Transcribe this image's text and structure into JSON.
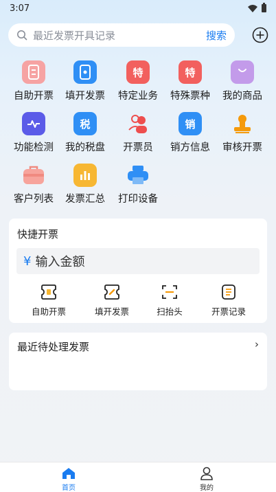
{
  "status": {
    "time": "3:07"
  },
  "search": {
    "placeholder": "最近发票开具记录",
    "button": "搜索"
  },
  "grid": [
    {
      "label": "自助开票",
      "icon": "self-invoice-icon",
      "color": "#f6a3a3"
    },
    {
      "label": "填开发票",
      "icon": "fill-invoice-icon",
      "color": "#2f8ff5"
    },
    {
      "label": "特定业务",
      "icon": "special-business-icon",
      "color": "#f2605e",
      "glyph": "特"
    },
    {
      "label": "特殊票种",
      "icon": "special-ticket-icon",
      "color": "#f2605e",
      "glyph": "特"
    },
    {
      "label": "我的商品",
      "icon": "shopping-bag-icon",
      "color": "#c39bea"
    },
    {
      "label": "功能检测",
      "icon": "pulse-check-icon",
      "color": "#5b5be8"
    },
    {
      "label": "我的税盘",
      "icon": "tax-disk-icon",
      "color": "#2f8ff5",
      "glyph": "税"
    },
    {
      "label": "开票员",
      "icon": "invoicer-users-icon",
      "color": "#ee4e4e"
    },
    {
      "label": "销方信息",
      "icon": "seller-info-icon",
      "color": "#2f8ff5",
      "glyph": "销"
    },
    {
      "label": "审核开票",
      "icon": "stamp-icon",
      "color": "#f59a0b"
    },
    {
      "label": "客户列表",
      "icon": "customer-briefcase-icon",
      "color": "#f08a80"
    },
    {
      "label": "发票汇总",
      "icon": "summary-chart-icon",
      "color": "#f7b733"
    },
    {
      "label": "打印设备",
      "icon": "printer-icon",
      "color": "#2f8ff5"
    }
  ],
  "quick": {
    "title": "快捷开票",
    "currency": "¥",
    "amount_placeholder": "输入金额",
    "items": [
      {
        "label": "自助开票",
        "icon": "self-invoice-outline-icon"
      },
      {
        "label": "填开发票",
        "icon": "fill-invoice-outline-icon"
      },
      {
        "label": "扫抬头",
        "icon": "scan-header-icon"
      },
      {
        "label": "开票记录",
        "icon": "invoice-record-icon"
      }
    ]
  },
  "pending": {
    "title": "最近待处理发票",
    "arrow": "›"
  },
  "tabbar": [
    {
      "label": "首页",
      "icon": "home-icon",
      "active": true,
      "color": "#1a7cf0"
    },
    {
      "label": "我的",
      "icon": "profile-icon",
      "active": false,
      "color": "#333333"
    }
  ]
}
